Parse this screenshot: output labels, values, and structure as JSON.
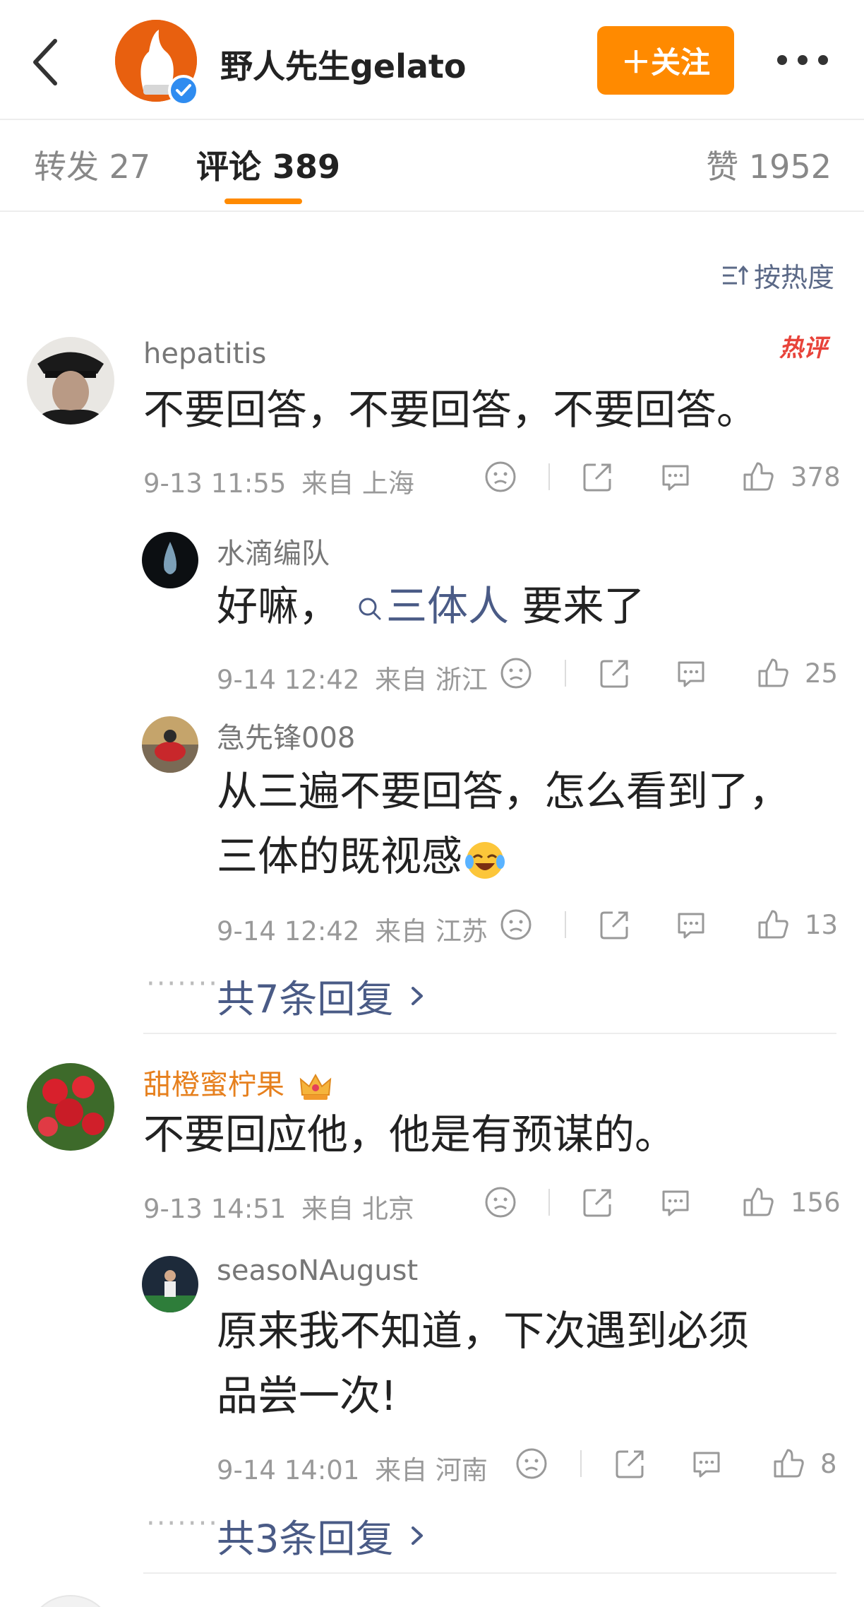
{
  "header": {
    "title": "野人先生gelato",
    "follow_label": "＋关注"
  },
  "tabs": {
    "repost": "转发 27",
    "comment": "评论 389",
    "like": "赞 1952"
  },
  "sort_label": "按热度",
  "comments": [
    {
      "user": "hepatitis",
      "badge": "热评",
      "text": "不要回答，不要回答，不要回答。",
      "time": "9-13 11:55",
      "location": "来自 上海",
      "likes": "378",
      "replies": [
        {
          "user": "水滴编队",
          "text_prefix": "好嘛，",
          "topic": "三体人",
          "text_suffix": " 要来了",
          "time": "9-14 12:42",
          "location": "来自 浙江",
          "likes": "25"
        },
        {
          "user": "急先锋008",
          "text_line1": "从三遍不要回答，怎么看到了，",
          "text_line2": "三体的既视感",
          "time": "9-14 12:42",
          "location": "来自 江苏",
          "likes": "13"
        }
      ],
      "more_replies": "共7条回复"
    },
    {
      "user": "甜橙蜜柠果",
      "text": "不要回应他，他是有预谋的。",
      "time": "9-13 14:51",
      "location": "来自 北京",
      "likes": "156",
      "replies": [
        {
          "user": "seasoNAugust",
          "text_line1": "原来我不知道，下次遇到必须",
          "text_line2": "品尝一次!",
          "time": "9-14 14:01",
          "location": "来自 河南",
          "likes": "8"
        }
      ],
      "more_replies": "共3条回复"
    }
  ],
  "colors": {
    "accent": "#ff8a00",
    "link": "#4a5b86",
    "hot": "#e8433a",
    "vip_name": "#e6801e"
  }
}
